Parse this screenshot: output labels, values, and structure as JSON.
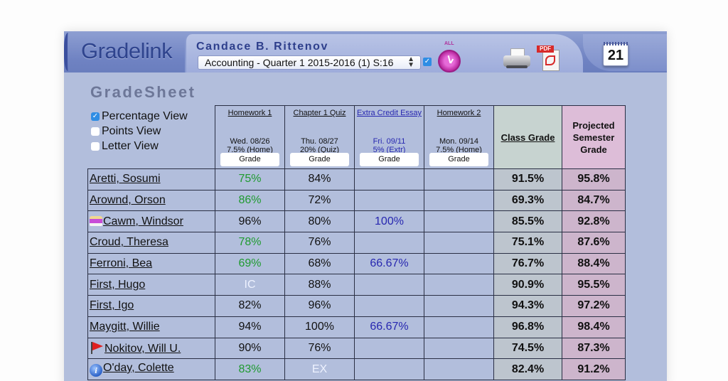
{
  "app": {
    "logo": "Gradelink",
    "teacher_name": "Candace B. Rittenov",
    "class_select_value": "Accounting - Quarter 1 2015-2016 (1) S:16",
    "class_checkbox_checked": true,
    "clock_label": "ALL",
    "calendar_day": "21"
  },
  "icons": {
    "clock": "alarm-clock-icon",
    "printer": "printer-icon",
    "pdf": "pdf-export-icon",
    "calendar": "calendar-icon"
  },
  "page": {
    "title": "GradeSheet"
  },
  "view_options": [
    {
      "label": "Percentage View",
      "checked": true
    },
    {
      "label": "Points View",
      "checked": false
    },
    {
      "label": "Letter View",
      "checked": false
    }
  ],
  "assignments": [
    {
      "name": "Homework 1",
      "date": "Wed. 08/26",
      "weight": "7.5% (Home)",
      "button": "Grade",
      "extra_credit": false
    },
    {
      "name": "Chapter 1 Quiz",
      "date": "Thu. 08/27",
      "weight": "20% (Quiz)",
      "button": "Grade",
      "extra_credit": false
    },
    {
      "name": "Extra Credit Essay",
      "date": "Fri. 09/11",
      "weight": "5% (Extr)",
      "button": "Grade",
      "extra_credit": true
    },
    {
      "name": "Homework 2",
      "date": "Mon. 09/14",
      "weight": "7.5% (Home)",
      "button": "Grade",
      "extra_credit": false
    }
  ],
  "summary_headers": {
    "class_grade": "Class Grade",
    "projected_l1": "Projected",
    "projected_l2": "Semester",
    "projected_l3": "Grade"
  },
  "colors": {
    "green_score": "#1f9a30",
    "extra_credit_blue": "#2727b0",
    "class_grade_bg": "#c7d3d0",
    "projected_bg": "#ddbdd8",
    "frame_bg": "#b2bedc"
  },
  "students": [
    {
      "name": "Aretti, Sosumi",
      "icon": "",
      "scores": [
        {
          "v": "75%",
          "s": "green"
        },
        {
          "v": "84%",
          "s": ""
        },
        {
          "v": "",
          "s": ""
        },
        {
          "v": "",
          "s": ""
        }
      ],
      "class_grade": "91.5%",
      "projected": "95.8%"
    },
    {
      "name": "Arownd, Orson",
      "icon": "",
      "scores": [
        {
          "v": "86%",
          "s": "green"
        },
        {
          "v": "72%",
          "s": ""
        },
        {
          "v": "",
          "s": ""
        },
        {
          "v": "",
          "s": ""
        }
      ],
      "class_grade": "69.3%",
      "projected": "84.7%"
    },
    {
      "name": "Cawm, Windsor",
      "icon": "birthday-cake-icon",
      "scores": [
        {
          "v": "96%",
          "s": ""
        },
        {
          "v": "80%",
          "s": ""
        },
        {
          "v": "100%",
          "s": "blue"
        },
        {
          "v": "",
          "s": ""
        }
      ],
      "class_grade": "85.5%",
      "projected": "92.8%"
    },
    {
      "name": "Croud, Theresa",
      "icon": "",
      "scores": [
        {
          "v": "78%",
          "s": "green"
        },
        {
          "v": "76%",
          "s": ""
        },
        {
          "v": "",
          "s": ""
        },
        {
          "v": "",
          "s": ""
        }
      ],
      "class_grade": "75.1%",
      "projected": "87.6%"
    },
    {
      "name": "Ferroni, Bea",
      "icon": "",
      "scores": [
        {
          "v": "69%",
          "s": "green"
        },
        {
          "v": "68%",
          "s": ""
        },
        {
          "v": "66.67%",
          "s": "blue"
        },
        {
          "v": "",
          "s": ""
        }
      ],
      "class_grade": "76.7%",
      "projected": "88.4%"
    },
    {
      "name": "First, Hugo",
      "icon": "",
      "scores": [
        {
          "v": "IC",
          "s": "white"
        },
        {
          "v": "88%",
          "s": ""
        },
        {
          "v": "",
          "s": ""
        },
        {
          "v": "",
          "s": ""
        }
      ],
      "class_grade": "90.9%",
      "projected": "95.5%"
    },
    {
      "name": "First, Igo",
      "icon": "",
      "scores": [
        {
          "v": "82%",
          "s": ""
        },
        {
          "v": "96%",
          "s": ""
        },
        {
          "v": "",
          "s": ""
        },
        {
          "v": "",
          "s": ""
        }
      ],
      "class_grade": "94.3%",
      "projected": "97.2%"
    },
    {
      "name": "Maygitt, Willie",
      "icon": "",
      "scores": [
        {
          "v": "94%",
          "s": ""
        },
        {
          "v": "100%",
          "s": ""
        },
        {
          "v": "66.67%",
          "s": "blue"
        },
        {
          "v": "",
          "s": ""
        }
      ],
      "class_grade": "96.8%",
      "projected": "98.4%"
    },
    {
      "name": "Nokitov, Will U.",
      "icon": "red-flag-icon",
      "scores": [
        {
          "v": "90%",
          "s": ""
        },
        {
          "v": "76%",
          "s": ""
        },
        {
          "v": "",
          "s": ""
        },
        {
          "v": "",
          "s": ""
        }
      ],
      "class_grade": "74.5%",
      "projected": "87.3%"
    },
    {
      "name": "O'day, Colette",
      "icon": "info-icon",
      "scores": [
        {
          "v": "83%",
          "s": "green"
        },
        {
          "v": "EX",
          "s": "white"
        },
        {
          "v": "",
          "s": ""
        },
        {
          "v": "",
          "s": ""
        }
      ],
      "class_grade": "82.4%",
      "projected": "91.2%"
    }
  ]
}
